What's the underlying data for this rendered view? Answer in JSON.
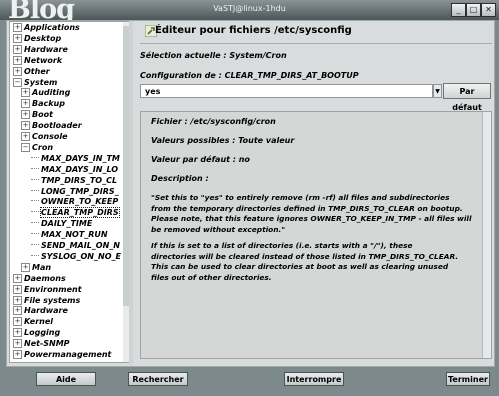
{
  "window": {
    "background_logo": "Blog",
    "title": "VaSTJ@linux-1hdu",
    "controls": [
      "_",
      "□",
      "✕"
    ]
  },
  "header": {
    "title": "Éditeur pour fichiers /etc/sysconfig",
    "icon": "wrench-icon"
  },
  "tree": {
    "items": [
      {
        "label": "Applications",
        "level": 0,
        "expander": "+"
      },
      {
        "label": "Desktop",
        "level": 0,
        "expander": "+"
      },
      {
        "label": "Hardware",
        "level": 0,
        "expander": "+"
      },
      {
        "label": "Network",
        "level": 0,
        "expander": "+"
      },
      {
        "label": "Other",
        "level": 0,
        "expander": "+"
      },
      {
        "label": "System",
        "level": 0,
        "expander": "−"
      },
      {
        "label": "Auditing",
        "level": 1,
        "expander": "+"
      },
      {
        "label": "Backup",
        "level": 1,
        "expander": "+"
      },
      {
        "label": "Boot",
        "level": 1,
        "expander": "+"
      },
      {
        "label": "Bootloader",
        "level": 1,
        "expander": "+"
      },
      {
        "label": "Console",
        "level": 1,
        "expander": "+"
      },
      {
        "label": "Cron",
        "level": 1,
        "expander": "−"
      },
      {
        "label": "MAX_DAYS_IN_TM",
        "level": 2,
        "expander": ""
      },
      {
        "label": "MAX_DAYS_IN_LO",
        "level": 2,
        "expander": ""
      },
      {
        "label": "TMP_DIRS_TO_CL",
        "level": 2,
        "expander": ""
      },
      {
        "label": "LONG_TMP_DIRS_",
        "level": 2,
        "expander": ""
      },
      {
        "label": "OWNER_TO_KEEP",
        "level": 2,
        "expander": ""
      },
      {
        "label": "CLEAR_TMP_DIRS",
        "level": 2,
        "expander": "",
        "selected": true
      },
      {
        "label": "DAILY_TIME",
        "level": 2,
        "expander": ""
      },
      {
        "label": "MAX_NOT_RUN",
        "level": 2,
        "expander": ""
      },
      {
        "label": "SEND_MAIL_ON_N",
        "level": 2,
        "expander": ""
      },
      {
        "label": "SYSLOG_ON_NO_E",
        "level": 2,
        "expander": ""
      },
      {
        "label": "Man",
        "level": 1,
        "expander": "+"
      },
      {
        "label": "Daemons",
        "level": 0,
        "expander": "+"
      },
      {
        "label": "Environment",
        "level": 0,
        "expander": "+"
      },
      {
        "label": "File systems",
        "level": 0,
        "expander": "+"
      },
      {
        "label": "Hardware",
        "level": 0,
        "expander": "+"
      },
      {
        "label": "Kernel",
        "level": 0,
        "expander": "+"
      },
      {
        "label": "Logging",
        "level": 0,
        "expander": "+"
      },
      {
        "label": "Net-SNMP",
        "level": 0,
        "expander": "+"
      },
      {
        "label": "Powermanagement",
        "level": 0,
        "expander": "+"
      }
    ]
  },
  "editor": {
    "current_selection": "Sélection actuelle : System/Cron",
    "config_label": "Configuration de : CLEAR_TMP_DIRS_AT_BOOTUP",
    "value": "yes",
    "default_button": "Par défaut"
  },
  "help": {
    "file": "Fichier : /etc/sysconfig/cron",
    "possible_values": "Valeurs possibles : Toute valeur",
    "default_value": "Valeur par défaut : no",
    "description_label": "Description :",
    "description_lines": [
      "\"Set this to \"yes\" to entirely remove (rm -rf) all  files and subdirectories",
      "from the temporary directories defined in TMP_DIRS_TO_CLEAR on bootup.",
      "Please note, that this feature ignores OWNER_TO_KEEP_IN_TMP - all files will",
      "be removed without exception.\"",
      "",
      "If this is set to a list of directories (i.e. starts with a \"/\"), these",
      "directories will be cleared instead of those listed in TMP_DIRS_TO_CLEAR.",
      "This can be used to clear directories at boot as well as clearing unused",
      "files out of other directories."
    ]
  },
  "buttons": {
    "help": "Aide",
    "search": "Rechercher",
    "interrupt": "Interrompre",
    "finish": "Terminer"
  },
  "colors": {
    "panel": "#d8dcdc",
    "help_bg": "#d4d7d6",
    "titlebar": "#4c5658"
  }
}
